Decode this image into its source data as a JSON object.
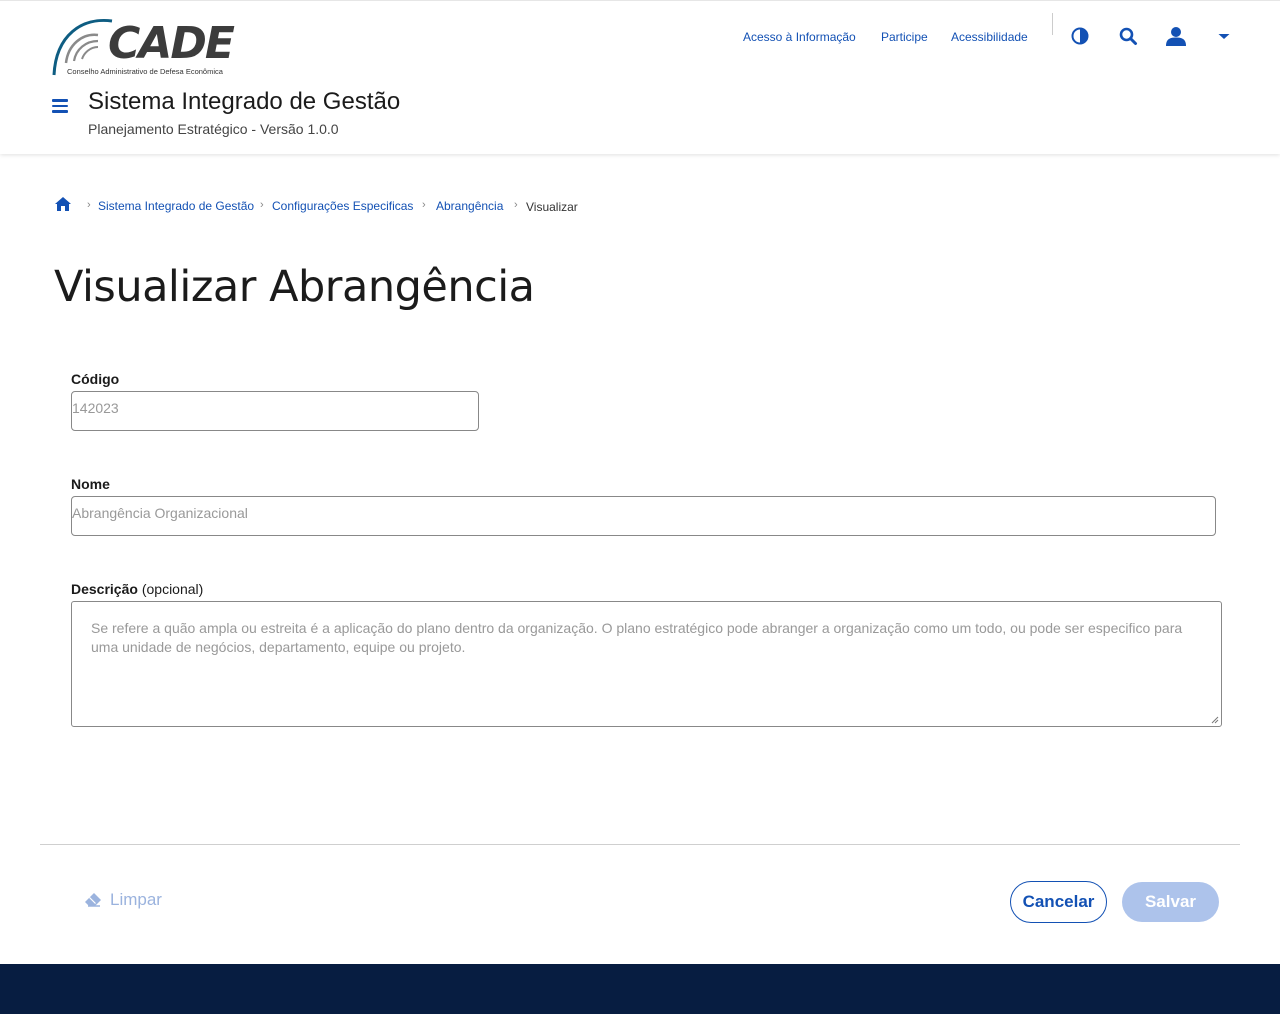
{
  "header": {
    "logo_text": "CADE",
    "logo_subtitle": "Conselho Administrativo de Defesa Econômica",
    "system_title": "Sistema Integrado de Gestão",
    "system_subtitle": "Planejamento Estratégico - Versão 1.0.0",
    "links": [
      "Acesso à Informação",
      "Participe",
      "Acessibilidade"
    ],
    "icons": [
      "menu-icon",
      "contrast-icon",
      "search-icon",
      "user-icon",
      "caret-down-icon"
    ],
    "accent_color": "#1351b4"
  },
  "breadcrumb": {
    "home_icon": "home-icon",
    "items": [
      "Sistema Integrado de Gestão",
      "Configurações Especificas",
      "Abrangência",
      "Visualizar"
    ]
  },
  "page": {
    "title": "Visualizar Abrangência"
  },
  "form": {
    "codigo": {
      "label": "Código",
      "value": "142023"
    },
    "nome": {
      "label": "Nome",
      "value": "Abrangência Organizacional"
    },
    "descricao": {
      "label": "Descrição",
      "optional": "(opcional)",
      "value": "Se refere a quão ampla ou estreita é a aplicação do plano dentro da organização. O plano estratégico pode abranger a organização como um todo, ou pode ser especifico para uma unidade de negócios, departamento, equipe ou projeto."
    }
  },
  "actions": {
    "clear_label": "Limpar",
    "clear_icon": "eraser-icon",
    "cancel_label": "Cancelar",
    "save_label": "Salvar"
  },
  "footer": {
    "color": "#071d41"
  }
}
